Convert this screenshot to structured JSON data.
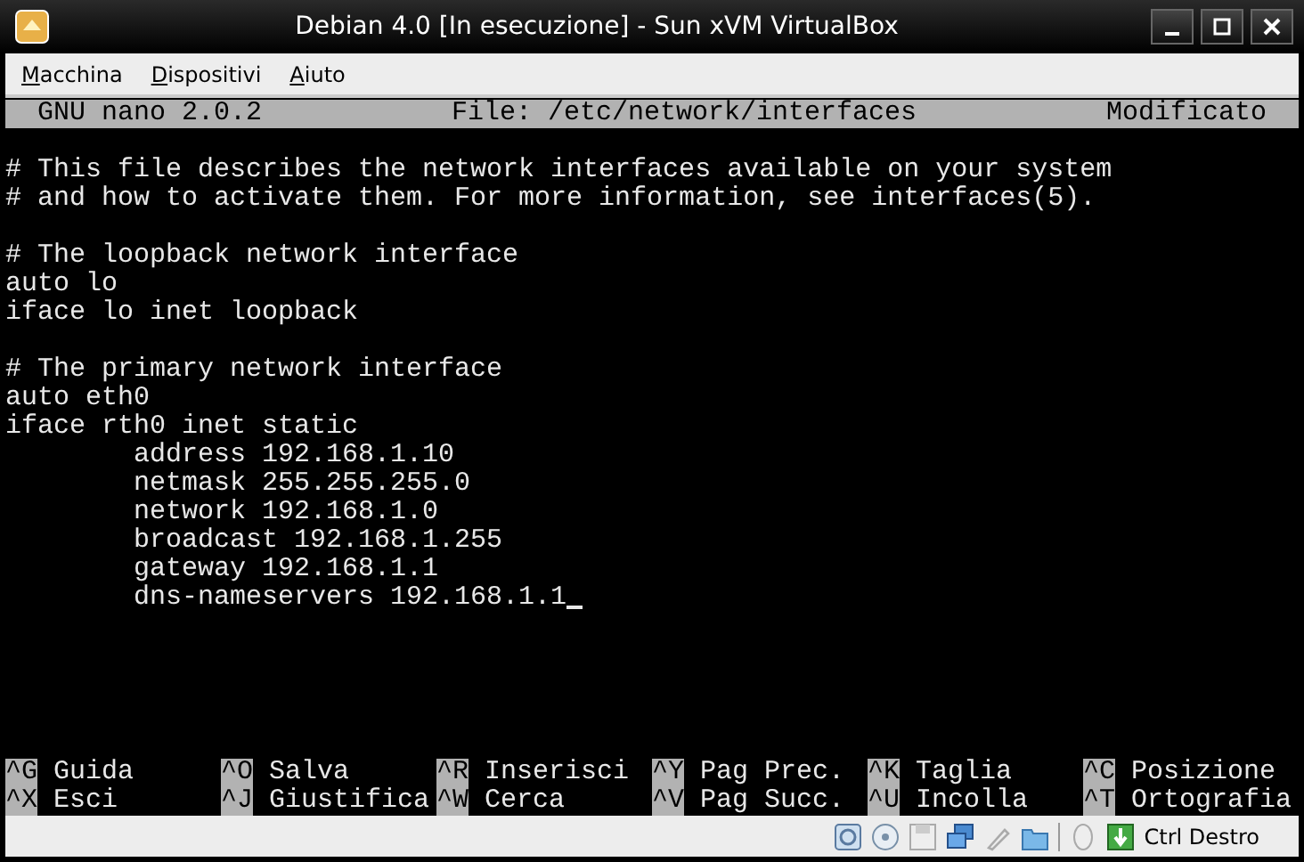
{
  "window": {
    "title": "Debian 4.0 [In esecuzione] - Sun xVM VirtualBox"
  },
  "menu": [
    "Macchina",
    "Dispositivi",
    "Aiuto"
  ],
  "nano_header": {
    "version": "GNU nano 2.0.2",
    "file": "File: /etc/network/interfaces",
    "status": "Modificato"
  },
  "blocks": [
    [
      {
        "text": "# This file describes the network interfaces available on your system",
        "indented": false
      },
      {
        "text": "# and how to activate them. For more information, see interfaces(5).",
        "indented": false
      }
    ],
    [
      {
        "text": "# The loopback network interface",
        "indented": false
      },
      {
        "text": "auto lo",
        "indented": false
      },
      {
        "text": "iface lo inet loopback",
        "indented": false
      }
    ],
    [
      {
        "text": "# The primary network interface",
        "indented": false
      },
      {
        "text": "auto eth0",
        "indented": false
      },
      {
        "text": "iface rth0 inet static",
        "indented": false
      },
      {
        "text": "address 192.168.1.10",
        "indented": true
      },
      {
        "text": "netmask 255.255.255.0",
        "indented": true
      },
      {
        "text": "network 192.168.1.0",
        "indented": true
      },
      {
        "text": "broadcast 192.168.1.255",
        "indented": true
      },
      {
        "text": "gateway 192.168.1.1",
        "indented": true
      },
      {
        "text": "dns-nameservers 192.168.1.1",
        "indented": true,
        "cursor": true
      }
    ]
  ],
  "shortcuts": [
    [
      {
        "key": "^G",
        "label": "Guida"
      },
      {
        "key": "^O",
        "label": "Salva"
      },
      {
        "key": "^R",
        "label": "Inserisci"
      },
      {
        "key": "^Y",
        "label": "Pag Prec."
      },
      {
        "key": "^K",
        "label": "Taglia"
      },
      {
        "key": "^C",
        "label": "Posizione"
      }
    ],
    [
      {
        "key": "^X",
        "label": "Esci"
      },
      {
        "key": "^J",
        "label": "Giustifica"
      },
      {
        "key": "^W",
        "label": "Cerca"
      },
      {
        "key": "^V",
        "label": "Pag Succ."
      },
      {
        "key": "^U",
        "label": "Incolla"
      },
      {
        "key": "^T",
        "label": "Ortografia"
      }
    ]
  ],
  "status_bar": {
    "host_key": "Ctrl Destro"
  }
}
